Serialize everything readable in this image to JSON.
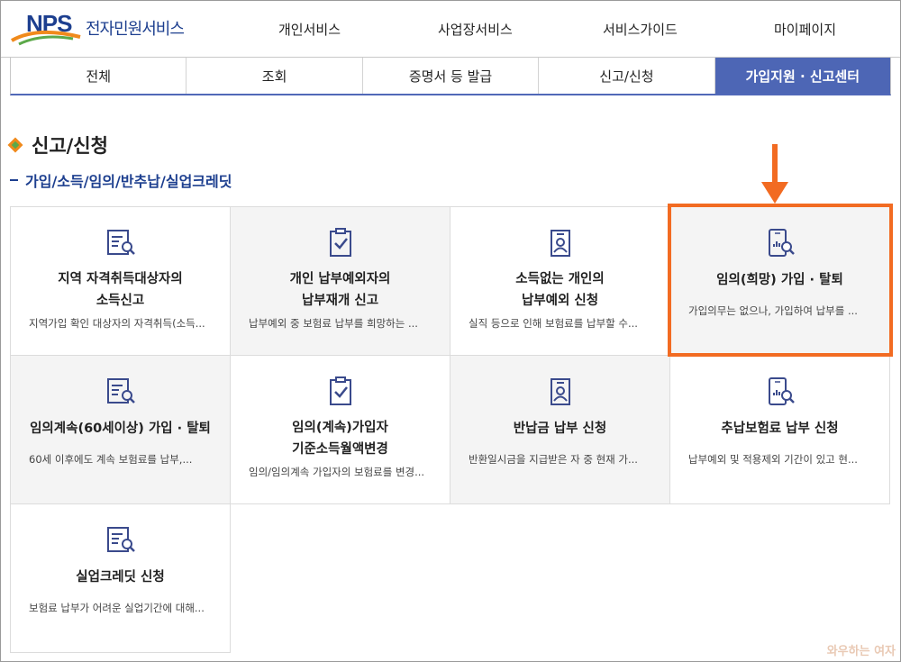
{
  "header": {
    "logo_mark": "NPS",
    "logo_text": "전자민원서비스",
    "nav": [
      "개인서비스",
      "사업장서비스",
      "서비스가이드",
      "마이페이지"
    ]
  },
  "tabs": [
    "전체",
    "조회",
    "증명서 등 발급",
    "신고/신청",
    "가입지원 · 신고센터"
  ],
  "active_tab": "가입지원 · 신고센터",
  "section": {
    "title": "신고/신청",
    "subtitle": "가입/소득/임의/반추납/실업크레딧"
  },
  "cards": [
    {
      "icon": "document-search-icon",
      "title_lines": [
        "지역 자격취득대상자의",
        "소득신고"
      ],
      "desc": "지역가입 확인 대상자의 자격취득(소득..."
    },
    {
      "icon": "clipboard-check-icon",
      "title_lines": [
        "개인 납부예외자의",
        "납부재개 신고"
      ],
      "desc": "납부예외 중 보험료 납부를 희망하는 ..."
    },
    {
      "icon": "id-card-icon",
      "title_lines": [
        "소득없는 개인의",
        "납부예외 신청"
      ],
      "desc": "실직 등으로 인해 보험료를 납부할 수..."
    },
    {
      "icon": "mobile-chart-search-icon",
      "title_lines": [
        "임의(희망) 가입 · 탈퇴"
      ],
      "desc": "가입의무는 없으나, 가입하여 납부를 ..."
    },
    {
      "icon": "document-search-icon",
      "title_lines": [
        "임의계속(60세이상) 가입 · 탈퇴"
      ],
      "desc": "60세 이후에도 계속 보험료를 납부,..."
    },
    {
      "icon": "clipboard-check-icon",
      "title_lines": [
        "임의(계속)가입자",
        "기준소득월액변경"
      ],
      "desc": "임의/임의계속 가입자의 보험료를 변경..."
    },
    {
      "icon": "id-card-icon",
      "title_lines": [
        "반납금 납부 신청"
      ],
      "desc": "반환일시금을 지급받은 자 중 현재 가..."
    },
    {
      "icon": "mobile-chart-search-icon",
      "title_lines": [
        "추납보험료 납부 신청"
      ],
      "desc": "납부예외 및 적용제외 기간이 있고 현..."
    },
    {
      "icon": "document-search-icon",
      "title_lines": [
        "실업크레딧 신청"
      ],
      "desc": "보험료 납부가 어려운 실업기간에 대해..."
    }
  ],
  "highlighted_card": "임의(희망) 가입 · 탈퇴",
  "watermark": "와우하는 여자",
  "colors": {
    "brand": "#1d3f8f",
    "active_tab": "#4d66b5",
    "highlight": "#f26b22",
    "icon": "#3a4a8c"
  }
}
